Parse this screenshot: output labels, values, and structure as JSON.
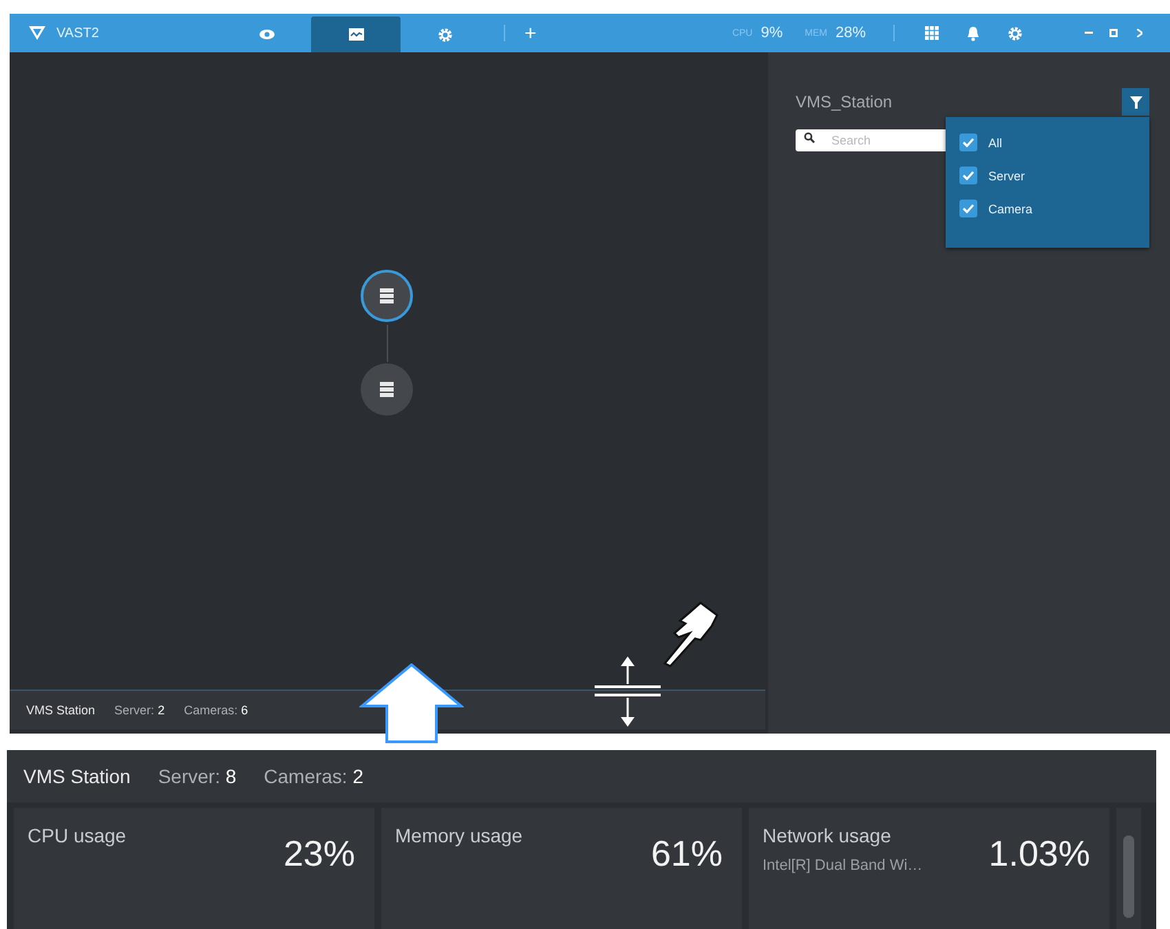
{
  "app": {
    "title": "VAST2"
  },
  "nav_tabs": [
    {
      "selected": false
    },
    {
      "selected": true
    },
    {
      "selected": false
    }
  ],
  "add_tab": "+",
  "system": {
    "cpu_label": "CPU",
    "cpu_value": "9%",
    "mem_label": "MEM",
    "mem_value": "28%"
  },
  "topology": {
    "nodes": [
      {
        "selected": true
      },
      {
        "selected": false
      }
    ]
  },
  "status_bar": {
    "name": "VMS Station",
    "server_label": "Server:",
    "server_count": "2",
    "cameras_label": "Cameras:",
    "cameras_count": "6"
  },
  "tree": {
    "title": "VMS_Station",
    "search_placeholder": "Search",
    "filter": {
      "expanded": true,
      "options": [
        {
          "label": "All",
          "checked": true
        },
        {
          "label": "Server",
          "checked": true
        },
        {
          "label": "Camera",
          "checked": true
        }
      ]
    }
  },
  "dashboard": {
    "status_bar": {
      "name": "VMS Station",
      "server_label": "Server:",
      "server_count": "8",
      "cameras_label": "Cameras:",
      "cameras_count": "2"
    },
    "cards": [
      {
        "title": "CPU usage",
        "value": "23%"
      },
      {
        "title": "Memory usage",
        "value": "61%"
      },
      {
        "title": "Network usage",
        "subtitle": "Intel[R] Dual Band Wi…",
        "value": "1.03%"
      }
    ]
  }
}
